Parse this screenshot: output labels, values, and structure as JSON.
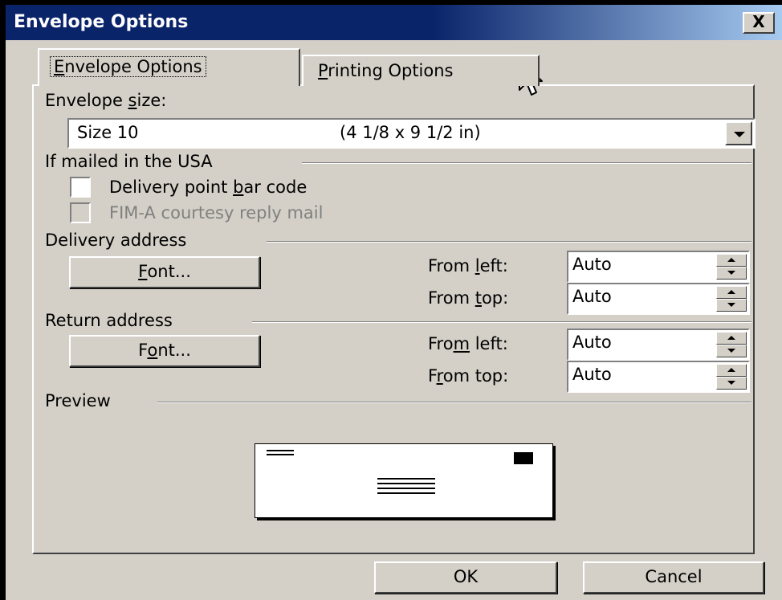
{
  "window": {
    "title": "Envelope Options",
    "close_label": "X"
  },
  "tabs": {
    "envelope_options": {
      "pre": "",
      "key": "E",
      "post": "nvelope Options"
    },
    "printing_options": {
      "pre": "",
      "key": "P",
      "post": "rinting Options"
    }
  },
  "envelope_size": {
    "label_pre": "Envelope ",
    "label_key": "s",
    "label_post": "ize:",
    "selected_name": "Size 10",
    "selected_dimensions": "(4 1/8 x 9 1/2 in)"
  },
  "usa_group": {
    "title": "If mailed in the USA",
    "delivery_barcode": {
      "pre": "Delivery point ",
      "key": "b",
      "post": "ar code",
      "checked": false
    },
    "fim_a": {
      "label": "FIM-A courtesy reply mail",
      "enabled": false,
      "checked": false
    }
  },
  "delivery_address": {
    "title": "Delivery address",
    "font_button": {
      "pre": "",
      "key": "F",
      "post": "ont..."
    },
    "from_left": {
      "pre": "From ",
      "key": "l",
      "post": "eft:",
      "value": "Auto"
    },
    "from_top": {
      "pre": "From ",
      "key": "t",
      "post": "op:",
      "value": "Auto"
    }
  },
  "return_address": {
    "title": "Return address",
    "font_button": {
      "pre": "F",
      "key": "o",
      "post": "nt..."
    },
    "from_left": {
      "pre": "Fro",
      "key": "m",
      "post": " left:",
      "value": "Auto"
    },
    "from_top": {
      "pre": "F",
      "key": "r",
      "post": "om top:",
      "value": "Auto"
    }
  },
  "preview": {
    "title": "Preview"
  },
  "buttons": {
    "ok": "OK",
    "cancel": "Cancel"
  },
  "colors": {
    "face": "#d4d0c8",
    "title_start": "#0a246a",
    "title_end": "#a6caf0"
  }
}
